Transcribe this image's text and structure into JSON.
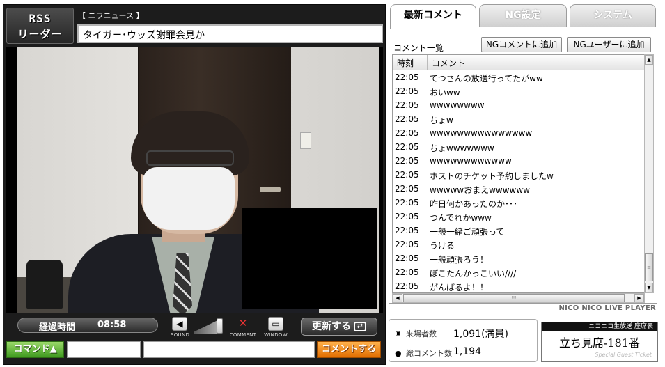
{
  "player": {
    "rss_line1": "RSS",
    "rss_line2": "リーダー",
    "news_category": "【 ニワニュース 】",
    "news_title": "タイガー･ウッズ謝罪会見か",
    "elapsed_label": "経過時間",
    "elapsed_value": "08:58",
    "controls": {
      "sound_label": "SOUND",
      "comment_label": "COMMENT",
      "window_label": "WINDOW",
      "refresh_label": "更新する"
    },
    "command_button": "コマンド▲",
    "command_input_value": "",
    "comment_input_value": "",
    "comment_submit": "コメントする"
  },
  "tabs": [
    {
      "label": "最新コメント",
      "active": true
    },
    {
      "label": "NG設定",
      "active": false
    },
    {
      "label": "システム",
      "active": false
    }
  ],
  "comment_panel": {
    "caption": "コメント一覧",
    "ng_comment_button": "NGコメントに追加",
    "ng_user_button": "NGユーザーに追加",
    "columns": [
      "時刻",
      "コメント"
    ],
    "rows": [
      {
        "time": "22:05",
        "text": "てつさんの放送行ってたがww"
      },
      {
        "time": "22:05",
        "text": "おいww"
      },
      {
        "time": "22:05",
        "text": "wwwwwwww"
      },
      {
        "time": "22:05",
        "text": "ちょw"
      },
      {
        "time": "22:05",
        "text": "wwwwwwwwwwwwwww"
      },
      {
        "time": "22:05",
        "text": "ちょwwwwwww"
      },
      {
        "time": "22:05",
        "text": "wwwwwwwwwwww"
      },
      {
        "time": "22:05",
        "text": "ホストのチケット予約しましたw"
      },
      {
        "time": "22:05",
        "text": "wwwwwおまえwwwwww"
      },
      {
        "time": "22:05",
        "text": "昨日何かあったのか･･･"
      },
      {
        "time": "22:05",
        "text": "つんでれかwww"
      },
      {
        "time": "22:05",
        "text": "一般一緒ご頑張って"
      },
      {
        "time": "22:05",
        "text": "うける"
      },
      {
        "time": "22:05",
        "text": "一般頑張ろう！"
      },
      {
        "time": "22:05",
        "text": "ぽこたんかっこいい////"
      },
      {
        "time": "22:05",
        "text": "がんばるよ！！"
      }
    ],
    "brand": "NICO NICO LIVE PLAYER"
  },
  "stats": {
    "visitors_label": "来場者数",
    "visitors_value": "1,091(満員)",
    "comments_label": "総コメント数",
    "comments_value": "1,194"
  },
  "ticket": {
    "header": "ニコニコ生放送 座席表",
    "seat": "立ち見席-181番",
    "footer": "Special Guest Ticket"
  },
  "colors": {
    "command_green": "#3f9a1f",
    "submit_orange": "#e26d00",
    "pip_border": "#bcd35a"
  }
}
